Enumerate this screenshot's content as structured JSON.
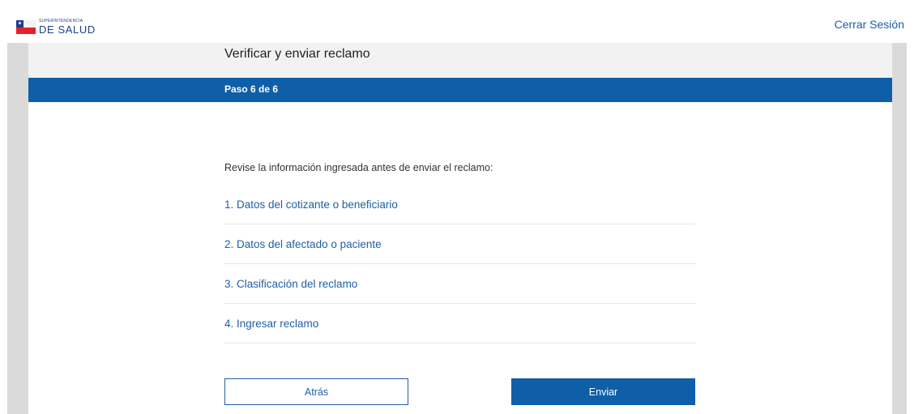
{
  "header": {
    "logo_small": "Superintendencia",
    "logo_big": "DE SALUD",
    "logout_label": "Cerrar Sesión"
  },
  "page": {
    "title": "Verificar y enviar reclamo",
    "step": "Paso 6 de 6",
    "intro": "Revise la información ingresada antes de enviar el reclamo:"
  },
  "sections": [
    {
      "label": "1. Datos del cotizante o beneficiario"
    },
    {
      "label": "2. Datos del afectado o paciente"
    },
    {
      "label": "3. Clasificación del reclamo"
    },
    {
      "label": "4. Ingresar reclamo"
    }
  ],
  "actions": {
    "back_label": "Atrás",
    "send_label": "Enviar"
  },
  "colors": {
    "primary": "#0f5ea8",
    "link": "#1f5fa6",
    "side_panel": "#dadada",
    "title_band": "#f2f2f2"
  },
  "icons": {
    "logo": "chile-flag-logo"
  }
}
